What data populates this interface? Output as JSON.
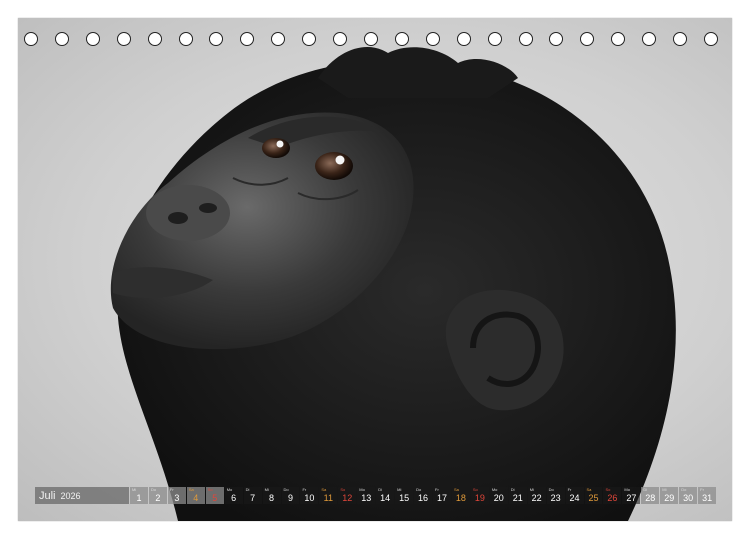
{
  "calendar": {
    "month": "Juli",
    "year": "2026",
    "days": [
      {
        "wd": "Mi",
        "num": "1",
        "type": "weekday",
        "tone": "light"
      },
      {
        "wd": "Do",
        "num": "2",
        "type": "weekday",
        "tone": "light"
      },
      {
        "wd": "Fr",
        "num": "3",
        "type": "weekday",
        "tone": "light"
      },
      {
        "wd": "Sa",
        "num": "4",
        "type": "sat",
        "tone": "light"
      },
      {
        "wd": "So",
        "num": "5",
        "type": "sun",
        "tone": "light"
      },
      {
        "wd": "Mo",
        "num": "6",
        "type": "weekday",
        "tone": "dark"
      },
      {
        "wd": "Di",
        "num": "7",
        "type": "weekday",
        "tone": "dark"
      },
      {
        "wd": "Mi",
        "num": "8",
        "type": "weekday",
        "tone": "dark"
      },
      {
        "wd": "Do",
        "num": "9",
        "type": "weekday",
        "tone": "dark"
      },
      {
        "wd": "Fr",
        "num": "10",
        "type": "weekday",
        "tone": "dark"
      },
      {
        "wd": "Sa",
        "num": "11",
        "type": "sat",
        "tone": "dark"
      },
      {
        "wd": "So",
        "num": "12",
        "type": "sun",
        "tone": "dark"
      },
      {
        "wd": "Mo",
        "num": "13",
        "type": "weekday",
        "tone": "dark"
      },
      {
        "wd": "Di",
        "num": "14",
        "type": "weekday",
        "tone": "dark"
      },
      {
        "wd": "Mi",
        "num": "15",
        "type": "weekday",
        "tone": "dark"
      },
      {
        "wd": "Do",
        "num": "16",
        "type": "weekday",
        "tone": "dark"
      },
      {
        "wd": "Fr",
        "num": "17",
        "type": "weekday",
        "tone": "dark"
      },
      {
        "wd": "Sa",
        "num": "18",
        "type": "sat",
        "tone": "dark"
      },
      {
        "wd": "So",
        "num": "19",
        "type": "sun",
        "tone": "dark"
      },
      {
        "wd": "Mo",
        "num": "20",
        "type": "weekday",
        "tone": "dark"
      },
      {
        "wd": "Di",
        "num": "21",
        "type": "weekday",
        "tone": "dark"
      },
      {
        "wd": "Mi",
        "num": "22",
        "type": "weekday",
        "tone": "dark"
      },
      {
        "wd": "Do",
        "num": "23",
        "type": "weekday",
        "tone": "dark"
      },
      {
        "wd": "Fr",
        "num": "24",
        "type": "weekday",
        "tone": "dark"
      },
      {
        "wd": "Sa",
        "num": "25",
        "type": "sat",
        "tone": "dark"
      },
      {
        "wd": "So",
        "num": "26",
        "type": "sun",
        "tone": "dark"
      },
      {
        "wd": "Mo",
        "num": "27",
        "type": "weekday",
        "tone": "dark"
      },
      {
        "wd": "Di",
        "num": "28",
        "type": "weekday",
        "tone": "light"
      },
      {
        "wd": "Mi",
        "num": "29",
        "type": "weekday",
        "tone": "light"
      },
      {
        "wd": "Do",
        "num": "30",
        "type": "weekday",
        "tone": "light"
      },
      {
        "wd": "Fr",
        "num": "31",
        "type": "weekday",
        "tone": "light"
      }
    ]
  },
  "binding": {
    "hole_count": 23,
    "hole_color": "#ffffff",
    "hole_border": "#222222"
  },
  "colors": {
    "saturday": "#e09a3a",
    "sunday": "#e0463a",
    "fur": "#1c1c1c"
  }
}
